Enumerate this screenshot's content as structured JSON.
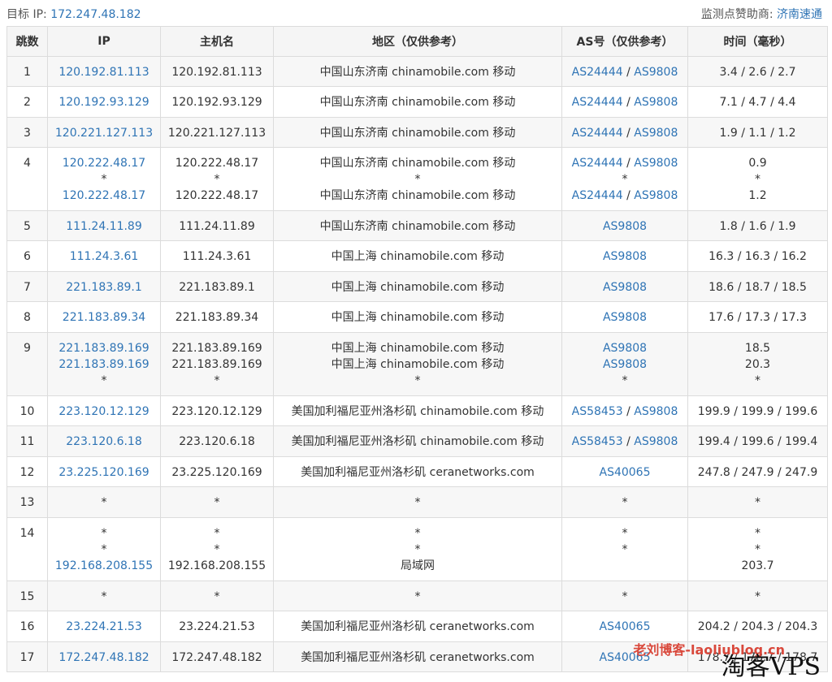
{
  "header": {
    "target_label": "目标 IP: ",
    "target_ip": "172.247.48.182",
    "sponsor_label": "监测点赞助商: ",
    "sponsor_name": "济南速通"
  },
  "columns": [
    "跳数",
    "IP",
    "主机名",
    "地区（仅供参考）",
    "AS号（仅供参考）",
    "时间（毫秒）"
  ],
  "rows": [
    {
      "hop": "1",
      "ip": [
        "120.192.81.113"
      ],
      "host": [
        "120.192.81.113"
      ],
      "region": [
        "中国山东济南 chinamobile.com 移动"
      ],
      "as": [
        [
          "AS24444",
          "AS9808"
        ]
      ],
      "time": [
        "3.4 / 2.6 / 2.7"
      ]
    },
    {
      "hop": "2",
      "ip": [
        "120.192.93.129"
      ],
      "host": [
        "120.192.93.129"
      ],
      "region": [
        "中国山东济南 chinamobile.com 移动"
      ],
      "as": [
        [
          "AS24444",
          "AS9808"
        ]
      ],
      "time": [
        "7.1 / 4.7 / 4.4"
      ]
    },
    {
      "hop": "3",
      "ip": [
        "120.221.127.113"
      ],
      "host": [
        "120.221.127.113"
      ],
      "region": [
        "中国山东济南 chinamobile.com 移动"
      ],
      "as": [
        [
          "AS24444",
          "AS9808"
        ]
      ],
      "time": [
        "1.9 / 1.1 / 1.2"
      ]
    },
    {
      "hop": "4",
      "ip": [
        "120.222.48.17",
        "*",
        "120.222.48.17"
      ],
      "host": [
        "120.222.48.17",
        "*",
        "120.222.48.17"
      ],
      "region": [
        "中国山东济南 chinamobile.com 移动",
        "*",
        "中国山东济南 chinamobile.com 移动"
      ],
      "as": [
        [
          "AS24444",
          "AS9808"
        ],
        [
          "*"
        ],
        [
          "AS24444",
          "AS9808"
        ]
      ],
      "time": [
        "0.9",
        "*",
        "1.2"
      ]
    },
    {
      "hop": "5",
      "ip": [
        "111.24.11.89"
      ],
      "host": [
        "111.24.11.89"
      ],
      "region": [
        "中国山东济南 chinamobile.com 移动"
      ],
      "as": [
        [
          "AS9808"
        ]
      ],
      "time": [
        "1.8 / 1.6 / 1.9"
      ]
    },
    {
      "hop": "6",
      "ip": [
        "111.24.3.61"
      ],
      "host": [
        "111.24.3.61"
      ],
      "region": [
        "中国上海 chinamobile.com 移动"
      ],
      "as": [
        [
          "AS9808"
        ]
      ],
      "time": [
        "16.3 / 16.3 / 16.2"
      ]
    },
    {
      "hop": "7",
      "ip": [
        "221.183.89.1"
      ],
      "host": [
        "221.183.89.1"
      ],
      "region": [
        "中国上海 chinamobile.com 移动"
      ],
      "as": [
        [
          "AS9808"
        ]
      ],
      "time": [
        "18.6 / 18.7 / 18.5"
      ]
    },
    {
      "hop": "8",
      "ip": [
        "221.183.89.34"
      ],
      "host": [
        "221.183.89.34"
      ],
      "region": [
        "中国上海 chinamobile.com 移动"
      ],
      "as": [
        [
          "AS9808"
        ]
      ],
      "time": [
        "17.6 / 17.3 / 17.3"
      ]
    },
    {
      "hop": "9",
      "ip": [
        "221.183.89.169",
        "221.183.89.169",
        "*"
      ],
      "host": [
        "221.183.89.169",
        "221.183.89.169",
        "*"
      ],
      "region": [
        "中国上海 chinamobile.com 移动",
        "中国上海 chinamobile.com 移动",
        "*"
      ],
      "as": [
        [
          "AS9808"
        ],
        [
          "AS9808"
        ],
        [
          "*"
        ]
      ],
      "time": [
        "18.5",
        "20.3",
        "*"
      ]
    },
    {
      "hop": "10",
      "ip": [
        "223.120.12.129"
      ],
      "host": [
        "223.120.12.129"
      ],
      "region": [
        "美国加利福尼亚州洛杉矶 chinamobile.com 移动"
      ],
      "as": [
        [
          "AS58453",
          "AS9808"
        ]
      ],
      "time": [
        "199.9 / 199.9 / 199.6"
      ]
    },
    {
      "hop": "11",
      "ip": [
        "223.120.6.18"
      ],
      "host": [
        "223.120.6.18"
      ],
      "region": [
        "美国加利福尼亚州洛杉矶 chinamobile.com 移动"
      ],
      "as": [
        [
          "AS58453",
          "AS9808"
        ]
      ],
      "time": [
        "199.4 / 199.6 / 199.4"
      ]
    },
    {
      "hop": "12",
      "ip": [
        "23.225.120.169"
      ],
      "host": [
        "23.225.120.169"
      ],
      "region": [
        "美国加利福尼亚州洛杉矶 ceranetworks.com"
      ],
      "as": [
        [
          "AS40065"
        ]
      ],
      "time": [
        "247.8 / 247.9 / 247.9"
      ]
    },
    {
      "hop": "13",
      "ip": [
        "*"
      ],
      "host": [
        "*"
      ],
      "region": [
        "*"
      ],
      "as": [
        [
          "*"
        ]
      ],
      "time": [
        "*"
      ]
    },
    {
      "hop": "14",
      "ip": [
        "*",
        "*",
        "192.168.208.155"
      ],
      "host": [
        "*",
        "*",
        "192.168.208.155"
      ],
      "region": [
        "*",
        "*",
        "局域网"
      ],
      "as": [
        [
          "*"
        ],
        [
          "*"
        ],
        []
      ],
      "time": [
        "*",
        "*",
        "203.7"
      ]
    },
    {
      "hop": "15",
      "ip": [
        "*"
      ],
      "host": [
        "*"
      ],
      "region": [
        "*"
      ],
      "as": [
        [
          "*"
        ]
      ],
      "time": [
        "*"
      ]
    },
    {
      "hop": "16",
      "ip": [
        "23.224.21.53"
      ],
      "host": [
        "23.224.21.53"
      ],
      "region": [
        "美国加利福尼亚州洛杉矶 ceranetworks.com"
      ],
      "as": [
        [
          "AS40065"
        ]
      ],
      "time": [
        "204.2 / 204.3 / 204.3"
      ]
    },
    {
      "hop": "17",
      "ip": [
        "172.247.48.182"
      ],
      "host": [
        "172.247.48.182"
      ],
      "region": [
        "美国加利福尼亚州洛杉矶 ceranetworks.com"
      ],
      "as": [
        [
          "AS40065"
        ]
      ],
      "time": [
        "178.7 / 178.7 / 178.7"
      ]
    }
  ],
  "watermark": {
    "blog": "老刘博客-laoliublog.cn",
    "brand": "淘客VPS"
  }
}
